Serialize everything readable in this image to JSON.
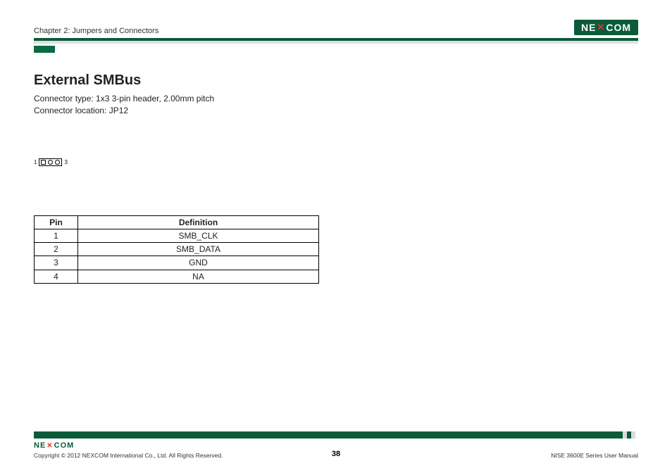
{
  "header": {
    "chapter": "Chapter 2: Jumpers and Connectors",
    "logo_text_pre": "NE",
    "logo_text_x": "★",
    "logo_text_post": "COM"
  },
  "section": {
    "title": "External SMBus",
    "line1": "Connector type: 1x3 3-pin header, 2.00mm pitch",
    "line2": "Connector location: JP12"
  },
  "diagram": {
    "left_label": "1",
    "right_label": "3"
  },
  "table": {
    "head_pin": "Pin",
    "head_def": "Definition",
    "rows": [
      {
        "pin": "1",
        "def": "SMB_CLK"
      },
      {
        "pin": "2",
        "def": "SMB_DATA"
      },
      {
        "pin": "3",
        "def": "GND"
      },
      {
        "pin": "4",
        "def": "NA"
      }
    ]
  },
  "footer": {
    "copyright": "Copyright © 2012 NEXCOM International Co., Ltd. All Rights Reserved.",
    "page": "38",
    "manual": "NISE 3600E Series User Manual"
  }
}
